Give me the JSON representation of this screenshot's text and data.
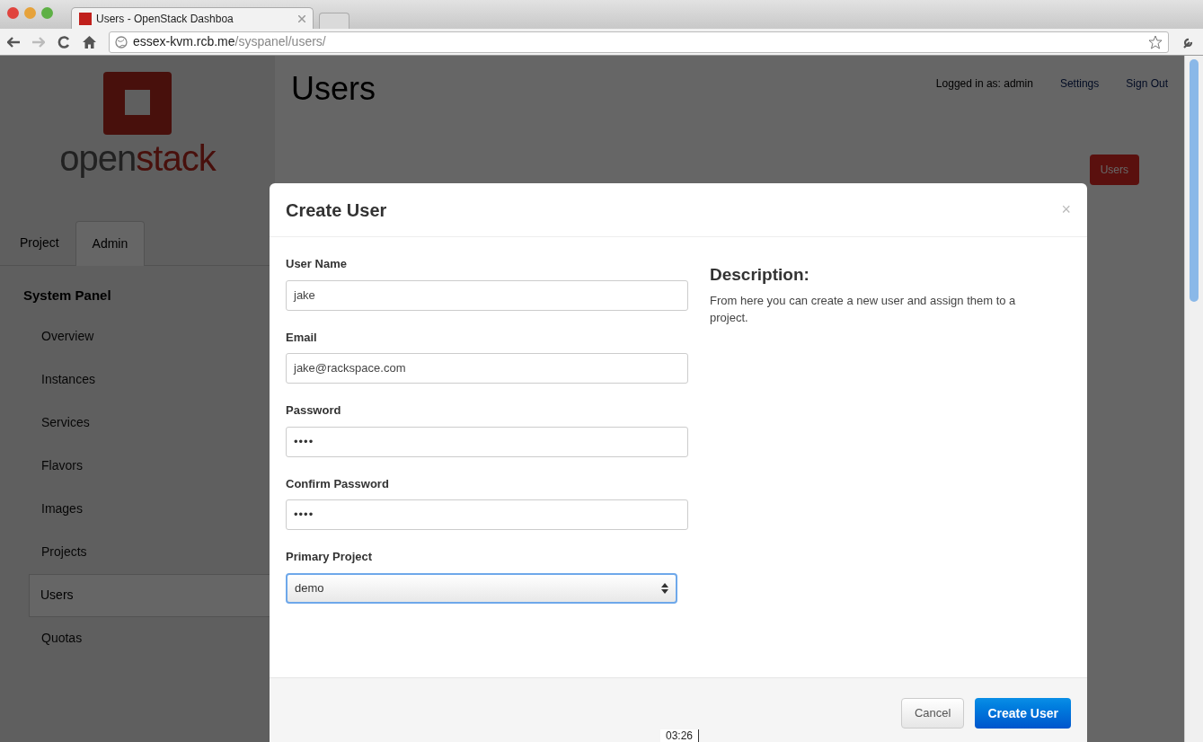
{
  "browser": {
    "tab_title": "Users - OpenStack Dashboa",
    "url_host": "essex-kvm.rcb.me",
    "url_path": "/syspanel/users/"
  },
  "sidebar": {
    "logo_text_a": "open",
    "logo_text_b": "stack",
    "tabs": [
      {
        "label": "Project",
        "selected": false
      },
      {
        "label": "Admin",
        "selected": true
      }
    ],
    "section": "System Panel",
    "items": [
      {
        "label": "Overview",
        "selected": false
      },
      {
        "label": "Instances",
        "selected": false
      },
      {
        "label": "Services",
        "selected": false
      },
      {
        "label": "Flavors",
        "selected": false
      },
      {
        "label": "Images",
        "selected": false
      },
      {
        "label": "Projects",
        "selected": false
      },
      {
        "label": "Users",
        "selected": true
      },
      {
        "label": "Quotas",
        "selected": false
      }
    ]
  },
  "header": {
    "title": "Users",
    "logged_in": "Logged in as: admin",
    "links": [
      "Settings",
      "Sign Out"
    ],
    "action_button": "Users"
  },
  "modal": {
    "title": "Create User",
    "close": "×",
    "fields": [
      {
        "label": "User Name",
        "kind": "text",
        "value": "jake"
      },
      {
        "label": "Email",
        "kind": "text",
        "value": "jake@rackspace.com"
      },
      {
        "label": "Password",
        "kind": "password",
        "value": "••••"
      },
      {
        "label": "Confirm Password",
        "kind": "password",
        "value": "••••"
      },
      {
        "label": "Primary Project",
        "kind": "select",
        "value": "demo"
      }
    ],
    "description_title": "Description:",
    "description": "From here you can create a new user and assign them to a project.",
    "cancel": "Cancel",
    "submit": "Create User"
  },
  "video_time": "03:26"
}
